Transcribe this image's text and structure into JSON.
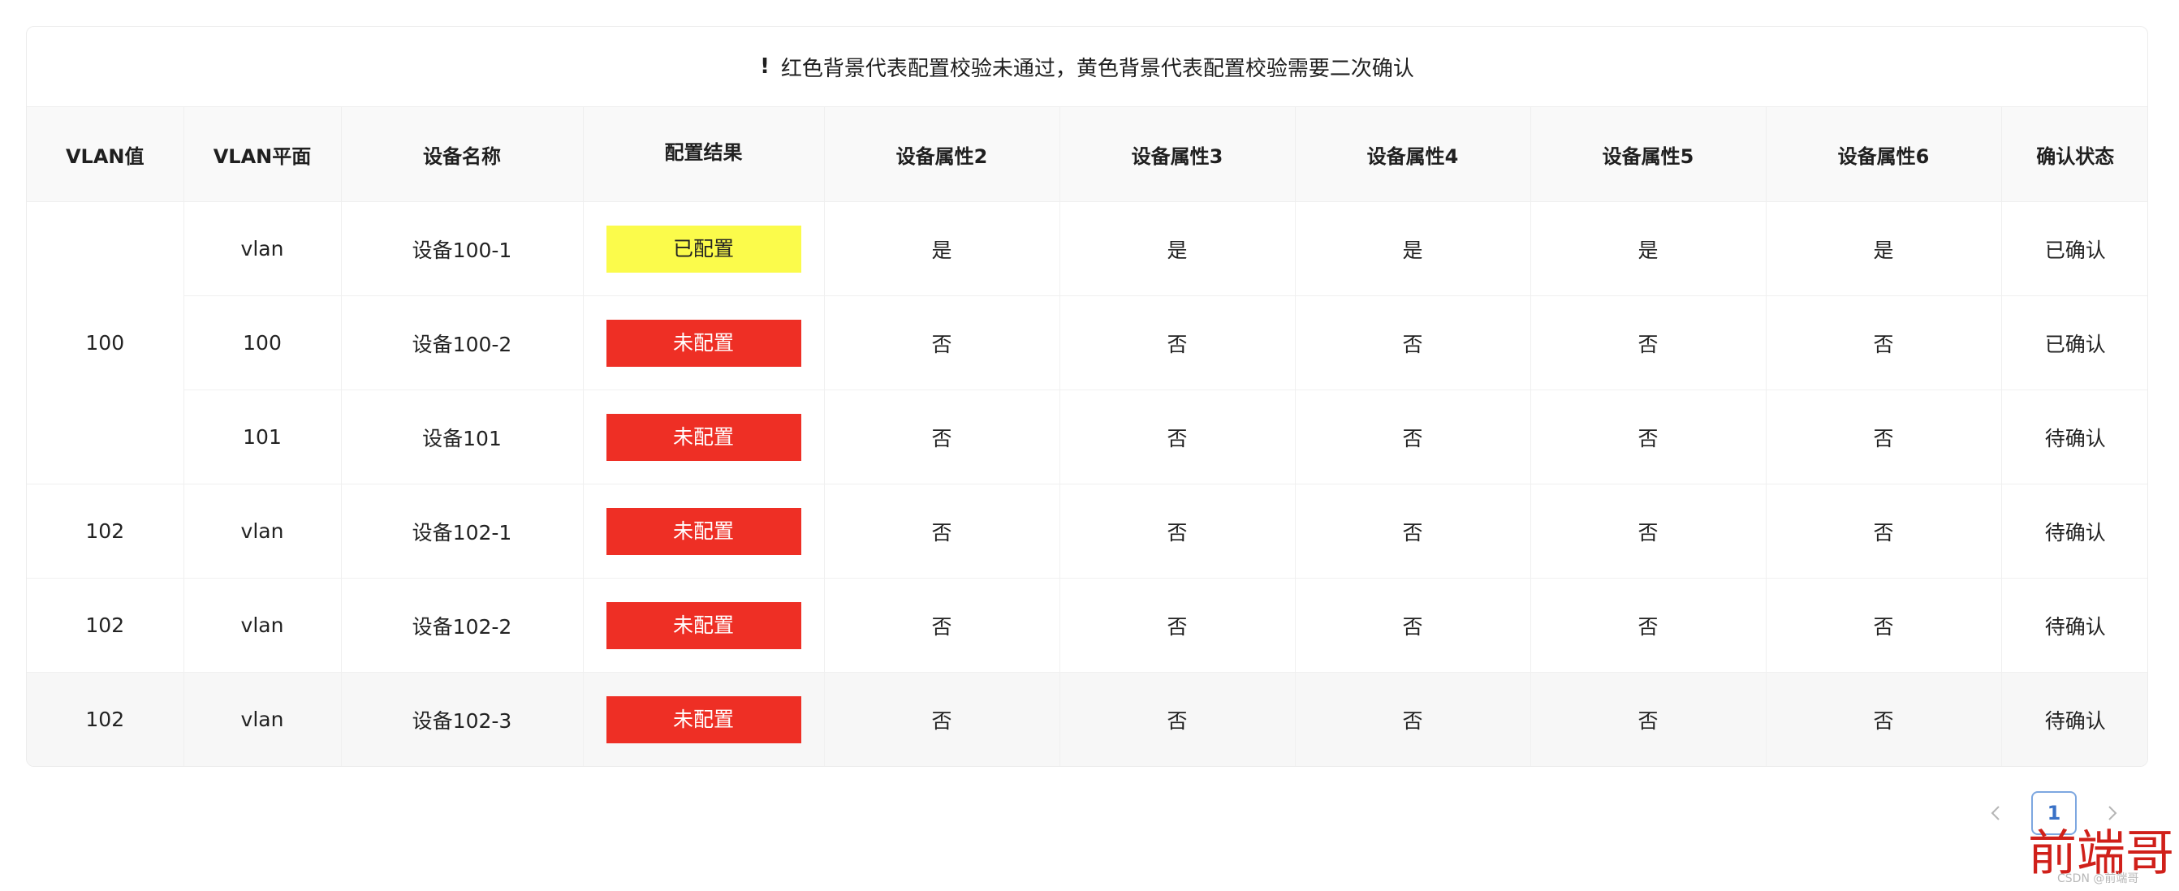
{
  "notice": {
    "icon": "exclamation-icon",
    "bang": "!",
    "text": "红色背景代表配置校验未通过，黄色背景代表配置校验需要二次确认"
  },
  "table": {
    "headers": [
      "VLAN值",
      "VLAN平面",
      "设备名称",
      "配置结果",
      "设备属性2",
      "设备属性3",
      "设备属性4",
      "设备属性5",
      "设备属性6",
      "确认状态"
    ],
    "group100_vlan": "100",
    "rows": [
      {
        "plane": "vlan",
        "device": "设备100-1",
        "result": "已配置",
        "attrs": [
          "是",
          "是",
          "是",
          "是",
          "是"
        ],
        "status": "已确认"
      },
      {
        "plane": "100",
        "device": "设备100-2",
        "result": "未配置",
        "attrs": [
          "否",
          "否",
          "否",
          "否",
          "否"
        ],
        "status": "已确认"
      },
      {
        "plane": "101",
        "device": "设备101",
        "result": "未配置",
        "attrs": [
          "否",
          "否",
          "否",
          "否",
          "否"
        ],
        "status": "待确认"
      },
      {
        "vlan": "102",
        "plane": "vlan",
        "device": "设备102-1",
        "result": "未配置",
        "attrs": [
          "否",
          "否",
          "否",
          "否",
          "否"
        ],
        "status": "待确认"
      },
      {
        "vlan": "102",
        "plane": "vlan",
        "device": "设备102-2",
        "result": "未配置",
        "attrs": [
          "否",
          "否",
          "否",
          "否",
          "否"
        ],
        "status": "待确认"
      },
      {
        "vlan": "102",
        "plane": "vlan",
        "device": "设备102-3",
        "result": "未配置",
        "attrs": [
          "否",
          "否",
          "否",
          "否",
          "否"
        ],
        "status": "待确认"
      }
    ],
    "colors": {
      "configured": "#fbfb4b",
      "not_configured": "#ee2f25"
    }
  },
  "pagination": {
    "current_page": "1",
    "prev_icon": "chevron-left-icon",
    "next_icon": "chevron-right-icon"
  },
  "watermark": {
    "big": "前端哥",
    "small": "CSDN @前端哥"
  }
}
